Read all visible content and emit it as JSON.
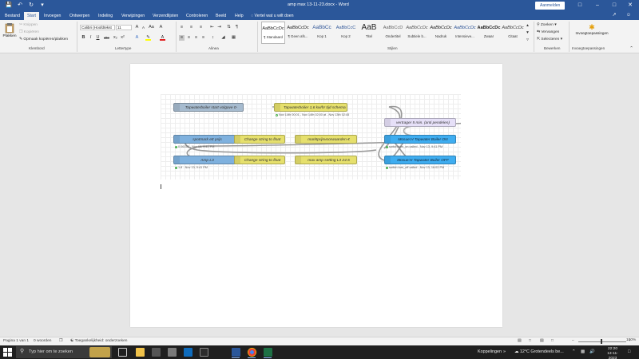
{
  "titlebar": {
    "title": "amp max 13-11-23.docx  -  Word",
    "signin": "Aanmelden",
    "icons": [
      "save-icon",
      "undo-icon",
      "redo-icon",
      "customize-quick-access-icon"
    ]
  },
  "tabs": [
    "Bestand",
    "Start",
    "Invoegen",
    "Ontwerpen",
    "Indeling",
    "Verwijzingen",
    "Verzendlijsten",
    "Controleren",
    "Beeld",
    "Help"
  ],
  "active_tab": "Start",
  "tellme": "Vertel wat u wilt doen",
  "ribbon": {
    "clipboard": {
      "paste": "Plakken",
      "cut": "Knippen",
      "copy": "Kopiëren",
      "format_painter": "Opmaak kopiëren/plakken",
      "label": "Klembord"
    },
    "font": {
      "name": "Calibri (Hoofdtekst",
      "size": "11",
      "label": "Lettertype",
      "buttons": [
        "A",
        "A",
        "Aa",
        "B",
        "I",
        "U",
        "abc",
        "x",
        "x",
        "A",
        "A",
        "A"
      ]
    },
    "paragraph": {
      "label": "Alinea"
    },
    "styles": {
      "label": "Stijlen",
      "items": [
        {
          "preview": "AaBbCcDc",
          "name": "¶ Standaard"
        },
        {
          "preview": "AaBbCcDc",
          "name": "¶ Geen afs..."
        },
        {
          "preview": "AaBbCc",
          "name": "Kop 1"
        },
        {
          "preview": "AaBbCcC",
          "name": "Kop 2"
        },
        {
          "preview": "AaB",
          "name": "Titel"
        },
        {
          "preview": "AaBbCcD",
          "name": "Ondertitel"
        },
        {
          "preview": "AaBbCcDc",
          "name": "Subtiele b..."
        },
        {
          "preview": "AaBbCcDc",
          "name": "Nadruk"
        },
        {
          "preview": "AaBbCcDc",
          "name": "Intensieve..."
        },
        {
          "preview": "AaBbCcDc",
          "name": "Zwaar"
        },
        {
          "preview": "AaBbCcDc",
          "name": "Citaat"
        }
      ]
    },
    "editing": {
      "label": "Bewerken",
      "find": "Zoeken",
      "replace": "Vervangen",
      "select": "Selecteren"
    },
    "addins": {
      "button": "Invoegtoepassingen",
      "label": "Invoegtoepassingen"
    }
  },
  "flow": {
    "nodes": [
      {
        "label": "Tapwaterboiler start volgave 0-",
        "status": ""
      },
      {
        "label": "Tapwaterboiler 1,6 kw/hr tijd schema",
        "status": "Nov 14th 00:01 - Nov 14th 02:00 at - Nov 13th 02:45"
      },
      {
        "label": "vertrager 5 min. (anti pendelen)",
        "status": ""
      },
      {
        "label": "spotmark ett prijs",
        "status": "0.06155 - Nov 13, 9:41 PM"
      },
      {
        "label": "Change string to float",
        "status": ""
      },
      {
        "label": "marktprijsvoorwaarden €",
        "status": ""
      },
      {
        "label": "Mosue:H Tapwater Boiler ON",
        "status": "switch.turn_on called - Nov 13, 9:41 PM"
      },
      {
        "label": "Amp L3",
        "status": "1.8 - Nov 13, 9:41 PM"
      },
      {
        "label": "Change string to float",
        "status": ""
      },
      {
        "label": "max amp setting L3 24.5",
        "status": ""
      },
      {
        "label": "Mosue:H Tapwater Boiler OFF",
        "status": "switch.turn_off called - Nov 13, 16:02 PM"
      }
    ]
  },
  "statusbar": {
    "page": "Pagina 1 van 1",
    "words": "0 woorden",
    "accessibility": "Toegankelijkheid: onderzoeken",
    "zoom": "100%"
  },
  "taskbar": {
    "search_placeholder": "Typ hier om te zoeken",
    "links": "Koppelingen",
    "weather": "12°C  Grotendeels be...",
    "time": "22:20",
    "date": "13-11-2023",
    "apps": [
      "task-view",
      "file-explorer",
      "media",
      "outlook",
      "terminal",
      "word",
      "chrome",
      "excel"
    ]
  },
  "colors": {
    "word_blue": "#2b579a",
    "inject": "#a6bbcf",
    "function": "#e6e06d",
    "service": "#3fadf0"
  }
}
